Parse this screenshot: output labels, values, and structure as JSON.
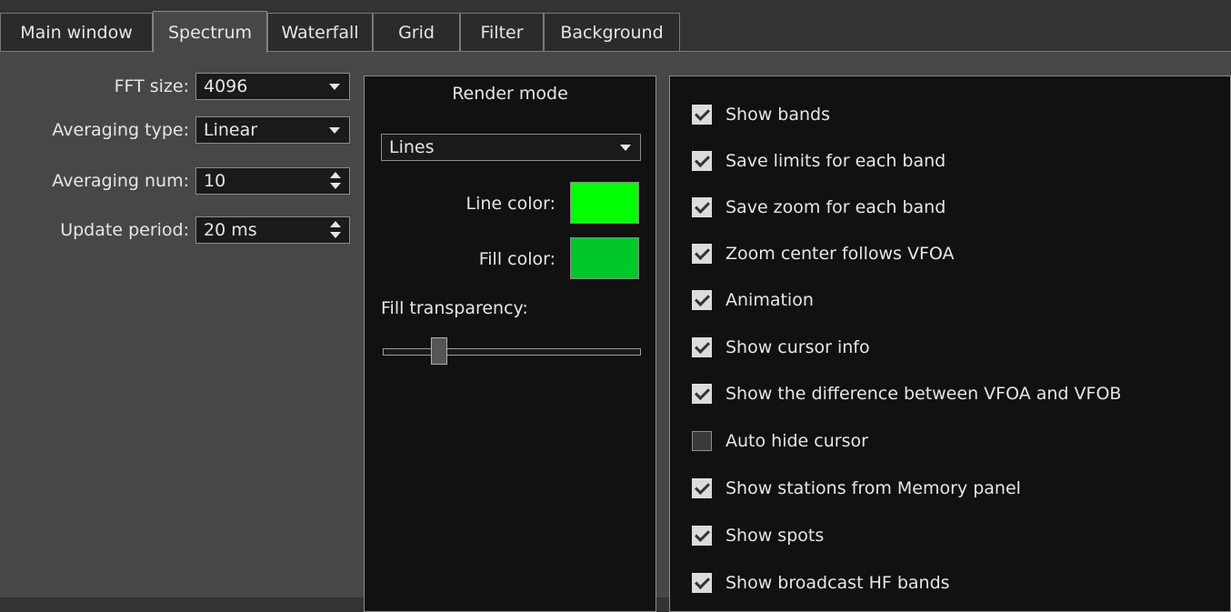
{
  "tabs": [
    {
      "label": "Main window",
      "active": false
    },
    {
      "label": "Spectrum",
      "active": true
    },
    {
      "label": "Waterfall",
      "active": false
    },
    {
      "label": "Grid",
      "active": false
    },
    {
      "label": "Filter",
      "active": false
    },
    {
      "label": "Background",
      "active": false
    }
  ],
  "form": {
    "fft_size": {
      "label": "FFT size:",
      "value": "4096"
    },
    "averaging_type": {
      "label": "Averaging type:",
      "value": "Linear"
    },
    "averaging_num": {
      "label": "Averaging num:",
      "value": "10"
    },
    "update_period": {
      "label": "Update period:",
      "value": "20 ms"
    }
  },
  "render": {
    "title": "Render mode",
    "mode": "Lines",
    "line_color_label": "Line color:",
    "line_color": "#00ff00",
    "fill_color_label": "Fill color:",
    "fill_color": "#00c82a",
    "fill_transparency_label": "Fill transparency:",
    "fill_transparency_fraction": 0.2
  },
  "options": [
    {
      "label": "Show bands",
      "checked": true
    },
    {
      "label": "Save limits for each band",
      "checked": true
    },
    {
      "label": "Save zoom for each band",
      "checked": true
    },
    {
      "label": "Zoom center follows VFOA",
      "checked": true
    },
    {
      "label": "Animation",
      "checked": true
    },
    {
      "label": "Show cursor info",
      "checked": true
    },
    {
      "label": "Show the difference between VFOA and VFOB",
      "checked": true
    },
    {
      "label": "Auto hide cursor",
      "checked": false
    },
    {
      "label": "Show stations from Memory panel",
      "checked": true
    },
    {
      "label": "Show spots",
      "checked": true
    },
    {
      "label": "Show broadcast HF bands",
      "checked": true
    }
  ],
  "icons": {
    "dropdown": "chevron-down-icon",
    "spinner": "spin-arrows-icon",
    "check": "checkmark-icon"
  }
}
